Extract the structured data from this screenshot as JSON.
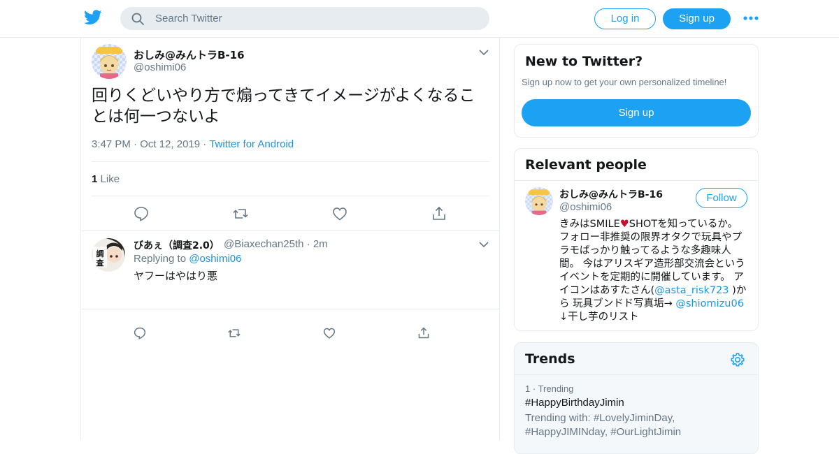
{
  "header": {
    "search_placeholder": "Search Twitter",
    "login_label": "Log in",
    "signup_label": "Sign up",
    "brand_color": "#1da1f2",
    "icons": [
      "twitter-bird-icon",
      "search-icon",
      "more-dots-icon"
    ]
  },
  "tweet": {
    "author_name": "おしみ@みんトラB-16",
    "author_handle": "@oshimi06",
    "text": "回りくどいやり方で煽ってきてイメージがよくなることは何一つないよ",
    "time": "3:47 PM",
    "date": "Oct 12, 2019",
    "source": "Twitter for Android",
    "like_count": "1",
    "like_label": "Like",
    "actions": [
      "reply-icon",
      "retweet-icon",
      "like-icon",
      "share-icon"
    ]
  },
  "reply": {
    "author_name": "びあぇ（調査2.0）",
    "author_handle": "@Biaxechan25th",
    "time_ago": "2m",
    "replying_to_label": "Replying to",
    "replying_to_handle": "@oshimi06",
    "text": "ヤフーはやはり悪",
    "avatar_text": "調査"
  },
  "sidebar": {
    "new_to_twitter": {
      "title": "New to Twitter?",
      "subtitle": "Sign up now to get your own personalized timeline!",
      "button_label": "Sign up"
    },
    "relevant_people": {
      "title": "Relevant people",
      "name": "おしみ@みんトラB-16",
      "handle": "@oshimi06",
      "follow_label": "Follow",
      "bio_part1": "きみはSMILE",
      "bio_heart": "♥",
      "bio_part2": "SHOTを知っているか。 フォロー非推奨の限界オタクで玩具やプラモばっかり触ってるような多趣味人間。 今はアリスギア造形部交流会というイベントを定期的に開催しています。 アイコンはあすたさん(",
      "bio_link1": "@asta_risk723",
      "bio_part3": " )から 玩具ブンドド写真垢→ ",
      "bio_link2": "@shiomizu06",
      "bio_part4": " ↓干し芋のリスト"
    },
    "trends": {
      "title": "Trends",
      "rank": "1",
      "trending_label": "Trending",
      "tag": "#HappyBirthdayJimin",
      "trending_with": "Trending with: #LovelyJiminDay, #HappyJIMINday, #OurLightJimin"
    }
  }
}
